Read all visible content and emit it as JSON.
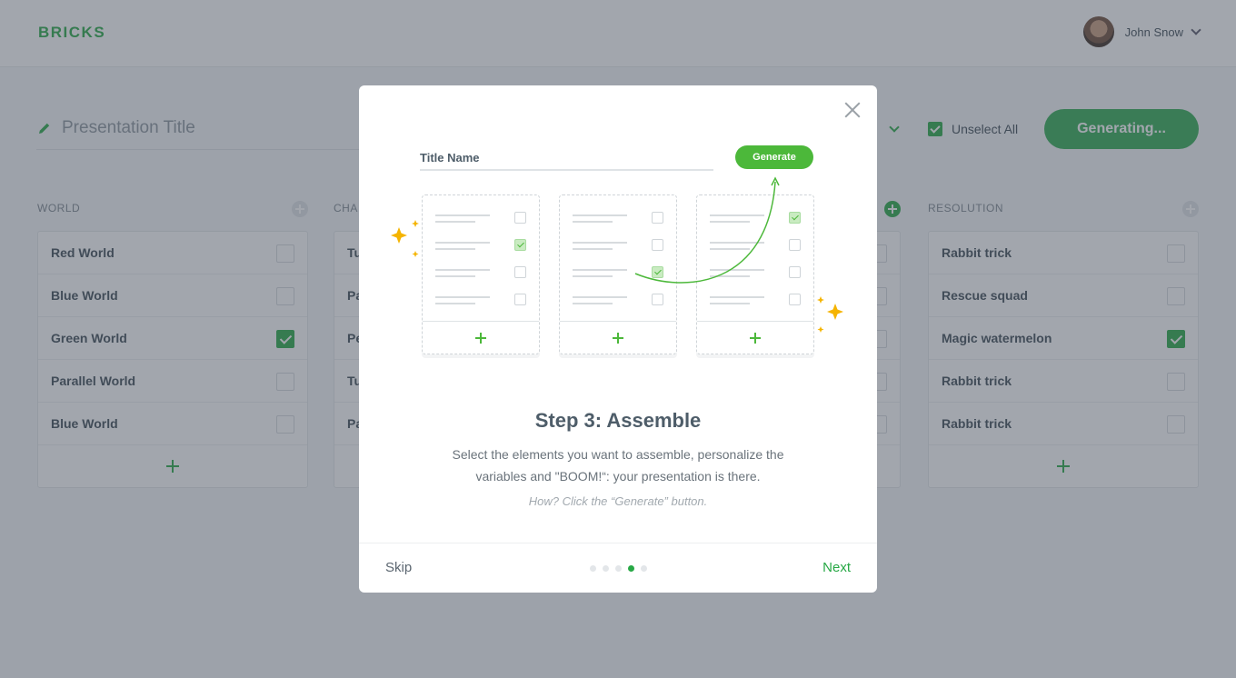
{
  "app": {
    "logo": "BRICKS",
    "user_name": "John Snow"
  },
  "toolbar": {
    "presentation_title_placeholder": "Presentation Title",
    "unselect_all_label": "Unselect All",
    "generate_button_label": "Generating..."
  },
  "columns": [
    {
      "header": "WORLD",
      "items": [
        {
          "label": "Red World",
          "checked": false
        },
        {
          "label": "Blue World",
          "checked": false
        },
        {
          "label": "Green World",
          "checked": true
        },
        {
          "label": "Parallel World",
          "checked": false
        },
        {
          "label": "Blue World",
          "checked": false
        }
      ]
    },
    {
      "header": "CHA",
      "items": [
        {
          "label": "Tu",
          "checked": false
        },
        {
          "label": "Pa",
          "checked": false
        },
        {
          "label": "Pe",
          "checked": false
        },
        {
          "label": "Tu",
          "checked": false
        },
        {
          "label": "Pa",
          "checked": false
        }
      ]
    },
    {
      "header": "RESOLUTION",
      "items": [
        {
          "label": "Rabbit trick",
          "checked": false
        },
        {
          "label": "Rescue squad",
          "checked": false
        },
        {
          "label": "Magic watermelon",
          "checked": true
        },
        {
          "label": "Rabbit trick",
          "checked": false
        },
        {
          "label": "Rabbit trick",
          "checked": false
        }
      ]
    }
  ],
  "modal": {
    "illustration": {
      "title_name": "Title Name",
      "generate_label": "Generate"
    },
    "step_title": "Step 3: Assemble",
    "step_description": "Select the elements you want to assemble, personalize the variables and \"BOOM!“: your presentation is there.",
    "step_hint": "How? Click the “Generate” button.",
    "skip_label": "Skip",
    "next_label": "Next",
    "pager": {
      "total": 5,
      "current": 4
    }
  },
  "colors": {
    "accent": "#27a845",
    "overlay": "rgba(70,78,92,0.5)",
    "star": "#f5b400"
  }
}
